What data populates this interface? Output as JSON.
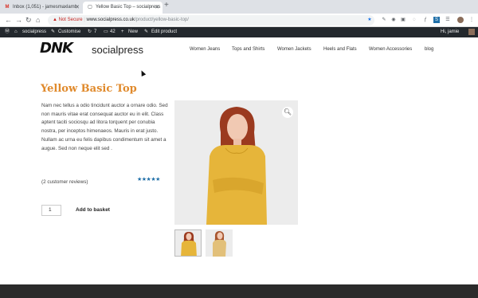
{
  "browser": {
    "tabs": [
      {
        "label": "Inbox (1,051) - jamesmaxlamb",
        "favicon": "M",
        "favicon_color": "#d93025",
        "active": false
      },
      {
        "label": "Yellow Basic Top – socialpress",
        "favicon": "▢",
        "favicon_color": "#5f6368",
        "active": true
      }
    ],
    "new_tab": "+",
    "address": {
      "security": "Not Secure",
      "host": "www.socialpress.co.uk",
      "path": "/product/yellow-basic-top/"
    }
  },
  "wpbar": {
    "site": "socialpress",
    "customise": "Customise",
    "updates": "7",
    "comments": "42",
    "new": "New",
    "edit": "Edit product",
    "user": "Hi, jamie"
  },
  "site": {
    "logo": "DNK",
    "title": "socialpress",
    "nav": [
      "Women Jeans",
      "Tops and Shirts",
      "Women Jackets",
      "Heels and Flats",
      "Women Accessories",
      "blog"
    ]
  },
  "product": {
    "title": "Yellow Basic Top",
    "description": "Nam nec tellus a odio tincidunt auctor a ornare odio. Sed non mauris vitae erat consequat auctor eu in elit. Class aptent taciti sociosqu ad litora torquent per conubia nostra, per inceptos himenaeos. Mauris in erat justo. Nullam ac urna eu felis dapibus condimentum sit amet a augue. Sed non neque elit sed .",
    "reviews": "(2 customer reviews)",
    "rating": 5,
    "rating_display": "★★★★★",
    "quantity": "1",
    "add_to_basket": "Add to basket"
  },
  "colors": {
    "accent": "#e08a2c",
    "adminbar": "#23282d",
    "shirt": "#e6b53a",
    "hair": "#9b3a1f"
  }
}
